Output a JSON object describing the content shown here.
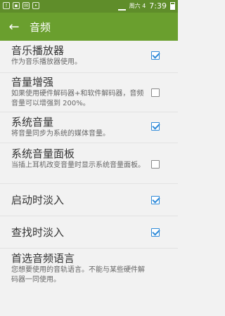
{
  "status_bar": {
    "day": "周六 4",
    "time": "7:39",
    "left_icons": [
      "notification-icon",
      "image-icon",
      "message-icon",
      "app-icon"
    ]
  },
  "app_bar": {
    "back_icon": "arrow-left-icon",
    "title": "音频"
  },
  "accent_color": "#2f8ad8",
  "bar_color": "#6a9f2e",
  "settings": [
    {
      "title": "音乐播放器",
      "summary": "作为音乐播放器使用。",
      "checked": true
    },
    {
      "title": "音量增强",
      "summary": "如果使用硬件解码器+和软件解码器，音频音量可以增强到 200%。",
      "checked": false
    },
    {
      "title": "系统音量",
      "summary": "将音量同步为系统的媒体音量。",
      "checked": true
    },
    {
      "title": "系统音量面板",
      "summary": "当插上耳机改变音量时显示系统音量面板。",
      "checked": false
    },
    {
      "title": "启动时淡入",
      "summary": "",
      "checked": true
    },
    {
      "title": "查找时淡入",
      "summary": "",
      "checked": true
    },
    {
      "title": "首选音频语言",
      "summary": "您想要使用的音轨语言。不能与某些硬件解码器一同使用。",
      "checked": null
    }
  ]
}
